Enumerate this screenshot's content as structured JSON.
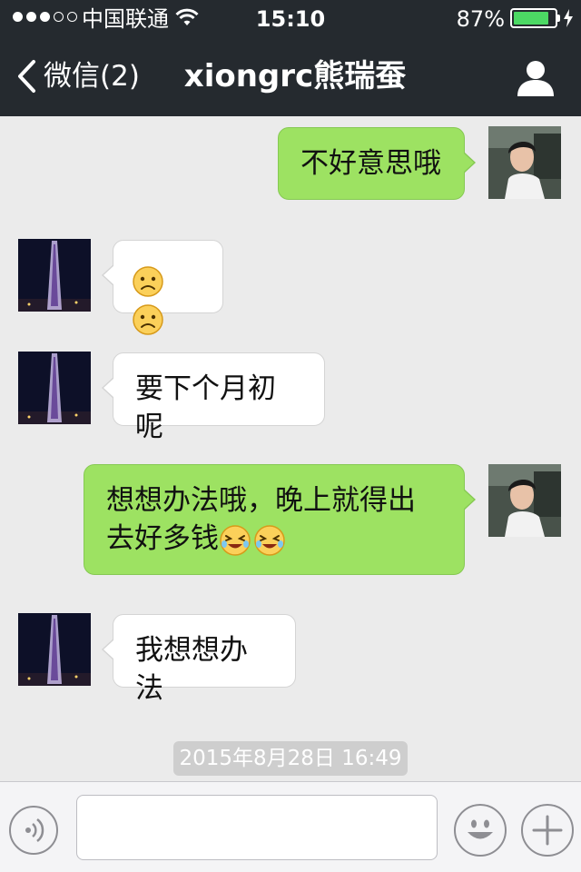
{
  "status_bar": {
    "carrier": "中国联通",
    "time": "15:10",
    "battery_percent": "87%",
    "battery_level": 0.87,
    "signal_bars_filled": 3,
    "signal_bars_total": 5,
    "battery_color": "#4cd964"
  },
  "nav": {
    "back_label": "微信(2)",
    "title": "xiongrc熊瑞蚕",
    "profile_icon": "person-icon"
  },
  "messages": [
    {
      "direction": "out",
      "text": "不好意思哦",
      "emojis": []
    },
    {
      "direction": "in",
      "text": "",
      "emojis": [
        "sad-face-emoji",
        "sad-face-emoji"
      ]
    },
    {
      "direction": "in",
      "text": "要下个月初呢",
      "emojis": []
    },
    {
      "direction": "out",
      "line1": "想想办法哦，晚上就得出",
      "line2": "去好多钱",
      "emojis": [
        "tearful-laugh-emoji",
        "tearful-laugh-emoji"
      ]
    },
    {
      "direction": "in",
      "text": "我想想办法",
      "emojis": []
    }
  ],
  "timestamp": "2015年8月28日 16:49",
  "input_bar": {
    "voice_icon": "voice-icon",
    "emoji_icon": "smiley-icon",
    "plus_icon": "plus-icon",
    "input_value": ""
  },
  "colors": {
    "header_bg": "#252a2f",
    "chat_bg": "#ebebeb",
    "outgoing_bubble": "#9de262",
    "incoming_bubble": "#ffffff"
  }
}
